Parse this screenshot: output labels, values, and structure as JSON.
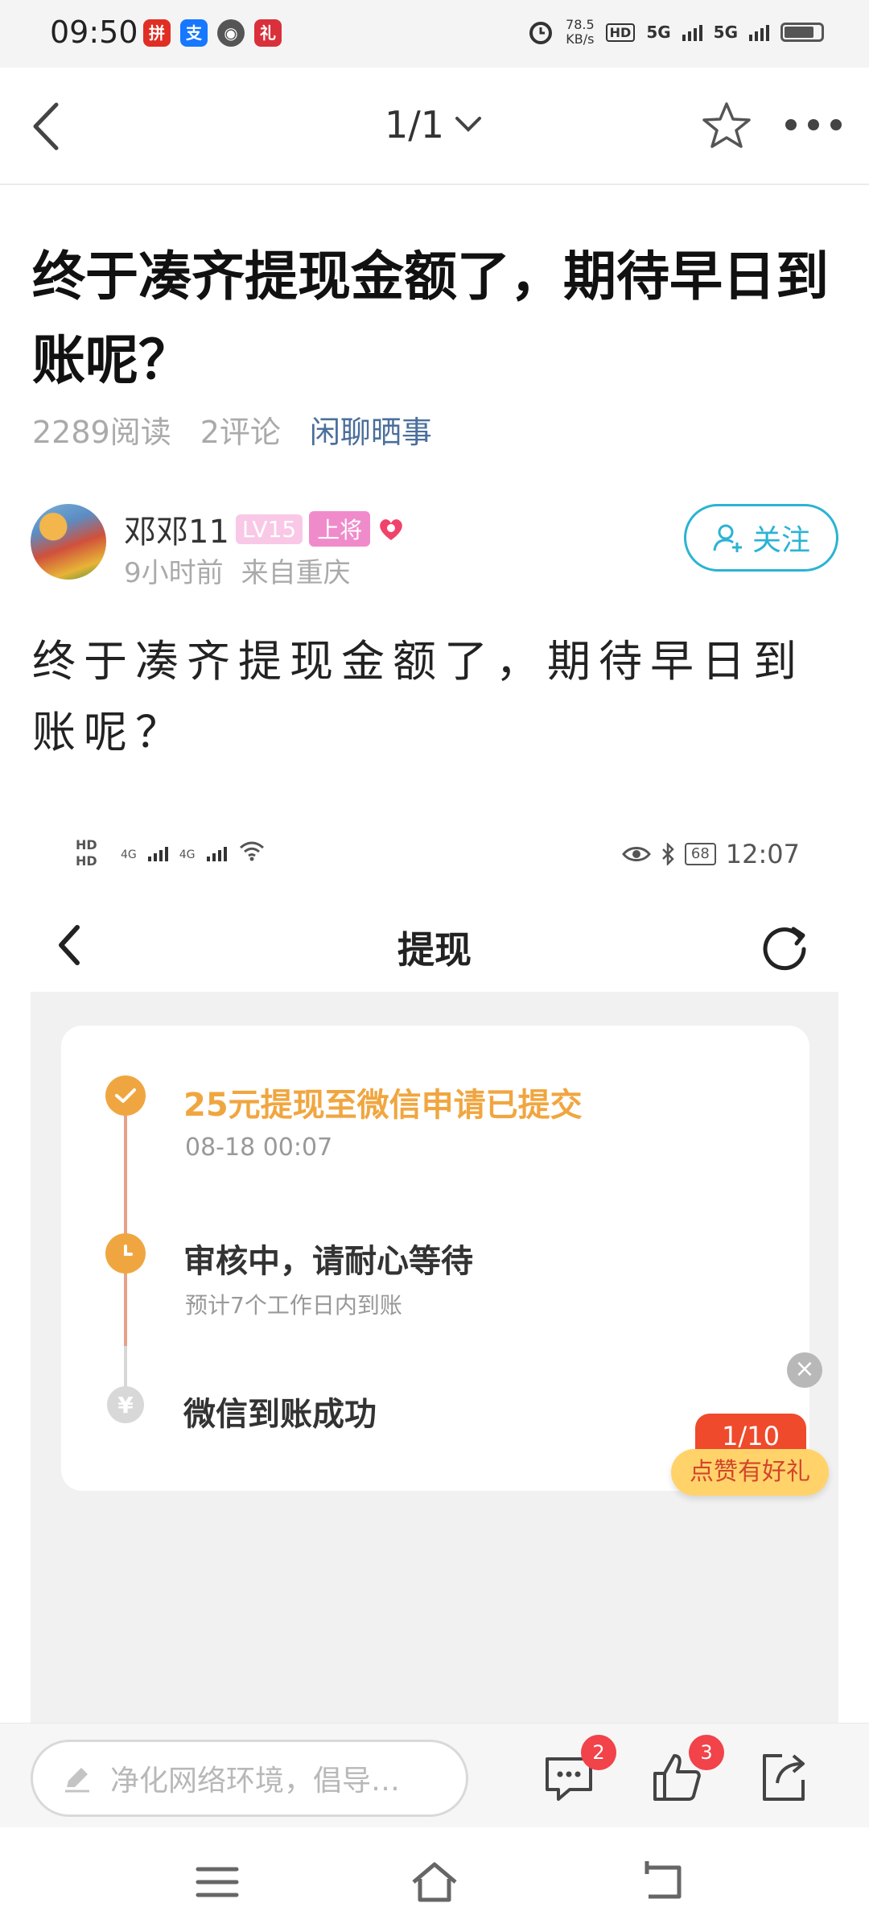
{
  "status_bar": {
    "time": "09:50",
    "apps": [
      {
        "icon": "pinduoduo-icon",
        "glyph": "拼",
        "color": "#e02e24"
      },
      {
        "icon": "alipay-icon",
        "glyph": "支",
        "color": "#1677ff"
      },
      {
        "icon": "compass-icon",
        "glyph": "◉",
        "color": "#555555"
      },
      {
        "icon": "gift-icon",
        "glyph": "礼",
        "color": "#d9303b"
      }
    ],
    "speed_value": "78.5",
    "speed_unit": "KB/s",
    "hd_label": "HD",
    "network_1": "5G",
    "network_2": "5G"
  },
  "header": {
    "page_indicator": "1/1"
  },
  "post": {
    "title": "终于凑齐提现金额了，期待早日到账呢？",
    "reads": "2289阅读",
    "comments": "2评论",
    "category": "闲聊晒事",
    "body": "终于凑齐提现金额了，期待早日到账呢？"
  },
  "author": {
    "name": "邓邓11",
    "level": "LV15",
    "rank": "上将",
    "time_ago": "9小时前",
    "location": "来自重庆",
    "follow_label": "关注"
  },
  "embedded_screenshot": {
    "status_time": "12:07",
    "battery": "68",
    "sim_label_1": "HD",
    "sim_label_2": "HD",
    "net_1": "4G",
    "net_2": "4G",
    "title": "提现",
    "timeline": [
      {
        "text": "25元提现至微信申请已提交",
        "time": "08-18 00:07",
        "state": "done"
      },
      {
        "text": "审核中，请耐心等待",
        "sub": "预计7个工作日内到账",
        "state": "pending"
      },
      {
        "text": "微信到账成功",
        "state": "future"
      }
    ]
  },
  "promo": {
    "count": "1/10",
    "label": "点赞有好礼",
    "close_glyph": "×"
  },
  "bottom_bar": {
    "comment_placeholder": "净化网络环境，倡导…",
    "comment_count": "2",
    "like_count": "3"
  },
  "colors": {
    "accent": "#2bb3d4",
    "category": "#4a6f9b",
    "timeline_done": "#f0a640",
    "badge": "#f2424a"
  }
}
